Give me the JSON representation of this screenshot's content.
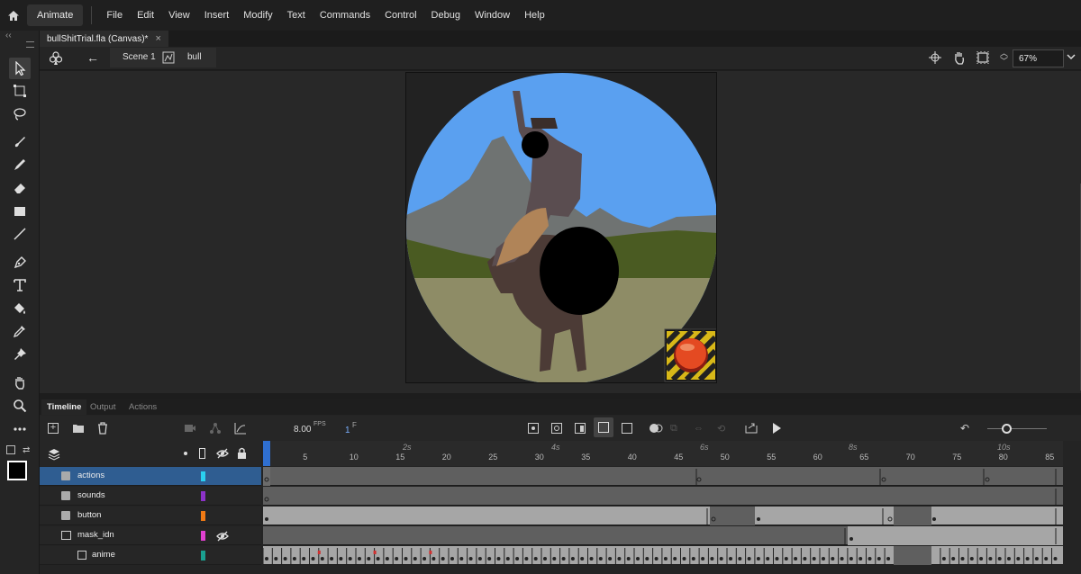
{
  "app": {
    "name": "Animate"
  },
  "menu": [
    "File",
    "Edit",
    "View",
    "Insert",
    "Modify",
    "Text",
    "Commands",
    "Control",
    "Debug",
    "Window",
    "Help"
  ],
  "document": {
    "tab_title": "bullShitTrial.fla (Canvas)*",
    "close": "×"
  },
  "editbar": {
    "scene": "Scene 1",
    "symbol": "bull",
    "zoom": "67%"
  },
  "panel_tabs": [
    "Timeline",
    "Output",
    "Actions"
  ],
  "timeline": {
    "fps": "8.00",
    "fps_unit": "FPS",
    "frame": "1",
    "frame_unit": "F",
    "seconds": [
      "2s",
      "4s",
      "6s",
      "8s",
      "10s"
    ],
    "frame_numbers": [
      "5",
      "10",
      "15",
      "20",
      "25",
      "30",
      "35",
      "40",
      "45",
      "50",
      "55",
      "60",
      "65",
      "70",
      "75",
      "80",
      "85"
    ],
    "layers": [
      {
        "name": "actions",
        "color": "#2ad0f0",
        "selected": true
      },
      {
        "name": "sounds",
        "color": "#8c32c8",
        "selected": false
      },
      {
        "name": "button",
        "color": "#f07a14",
        "selected": false
      },
      {
        "name": "mask_idn",
        "color": "#e040d0",
        "selected": false
      },
      {
        "name": "anime",
        "color": "#1aa090",
        "selected": false
      }
    ]
  },
  "colors": {
    "accent": "#2f5d91",
    "sky": "#5aa0f0",
    "mountain": "#6f7372",
    "ground": "#8e8c66",
    "grass": "#4a5b22"
  }
}
